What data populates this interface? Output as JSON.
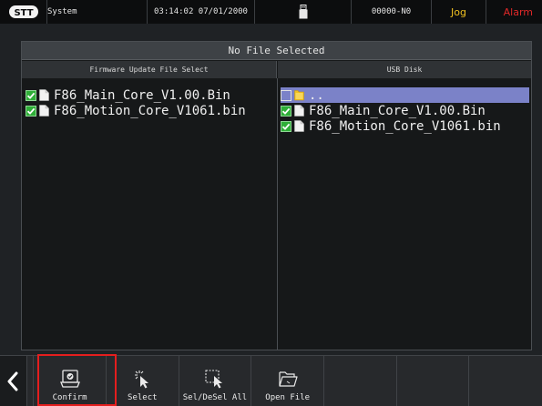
{
  "status_bar": {
    "logo_text": "STT",
    "mode": "System",
    "datetime": "03:14:02 07/01/2000",
    "usb_icon": "usb-drive-icon",
    "program": "00000-N0",
    "jog_label": "Jog",
    "alarm_label": "Alarm",
    "colors": {
      "jog": "#f0c020",
      "alarm": "#e02828"
    }
  },
  "panel": {
    "title": "No File Selected",
    "left": {
      "header": "Firmware Update File Select",
      "files": [
        {
          "name": "F86_Main_Core_V1.00.Bin",
          "checked": true
        },
        {
          "name": "F86_Motion_Core_V1061.bin",
          "checked": true
        }
      ]
    },
    "right": {
      "header": "USB Disk",
      "files": [
        {
          "name": "..",
          "checked": false,
          "type": "folder",
          "selected": true
        },
        {
          "name": "F86_Main_Core_V1.00.Bin",
          "checked": true,
          "type": "file"
        },
        {
          "name": "F86_Motion_Core_V1061.bin",
          "checked": true,
          "type": "file"
        }
      ]
    }
  },
  "toolbar": {
    "back_icon": "chevron-left-icon",
    "buttons": [
      {
        "label": "Confirm",
        "icon": "confirm-icon",
        "highlighted": true
      },
      {
        "label": "Select",
        "icon": "cursor-select-icon"
      },
      {
        "label": "Sel/DeSel All",
        "icon": "select-area-icon"
      },
      {
        "label": "Open File",
        "icon": "open-folder-icon"
      }
    ],
    "highlight_color": "#e41e1e"
  }
}
